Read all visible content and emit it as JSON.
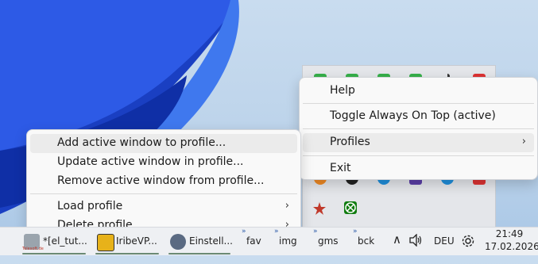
{
  "wallpaper": {
    "accent": "#1f4fd6",
    "background": "#c3d7ec"
  },
  "tray_overflow": {
    "icons": [
      "green-app-icon",
      "green-app-icon",
      "green-app-icon",
      "green-app-icon",
      "signal-icon",
      "red-app-icon",
      "orange-app-icon",
      "black-circle-icon",
      "blue-circle-icon",
      "purple-app-icon",
      "blue-circle-icon",
      "red-app-icon",
      "red-star-icon",
      "xbox-icon"
    ]
  },
  "context_menu": {
    "items": [
      {
        "label": "Help",
        "submenu": false
      },
      {
        "label": "Toggle Always On Top (active)",
        "submenu": false
      },
      {
        "label": "Profiles",
        "submenu": true,
        "arrow": "›"
      },
      {
        "label": "Exit",
        "submenu": false
      }
    ]
  },
  "profiles_submenu": {
    "items": [
      {
        "label": "Add active window to profile..."
      },
      {
        "label": "Update active window in profile..."
      },
      {
        "label": "Remove active window from profile..."
      },
      {
        "label": "Load profile",
        "arrow": "›"
      },
      {
        "label": "Delete profile",
        "arrow": "›"
      }
    ]
  },
  "taskbar": {
    "apps": [
      {
        "label": "*[el_tut...",
        "icon": "telesoft-icon",
        "sublabel": "Telesoft.de"
      },
      {
        "label": "IribeVP...",
        "icon": "yellow-app-icon"
      },
      {
        "label": "Einstell...",
        "icon": "settings-gear-icon"
      }
    ],
    "folders": [
      "fav",
      "img",
      "gms",
      "bck"
    ],
    "folder_chevron": "»",
    "tray_chevron": "∧",
    "volume_icon": "speaker-icon",
    "language": "DEU",
    "settings_icon": "gear-icon",
    "time": "21:49",
    "date": "17.02.2026"
  }
}
